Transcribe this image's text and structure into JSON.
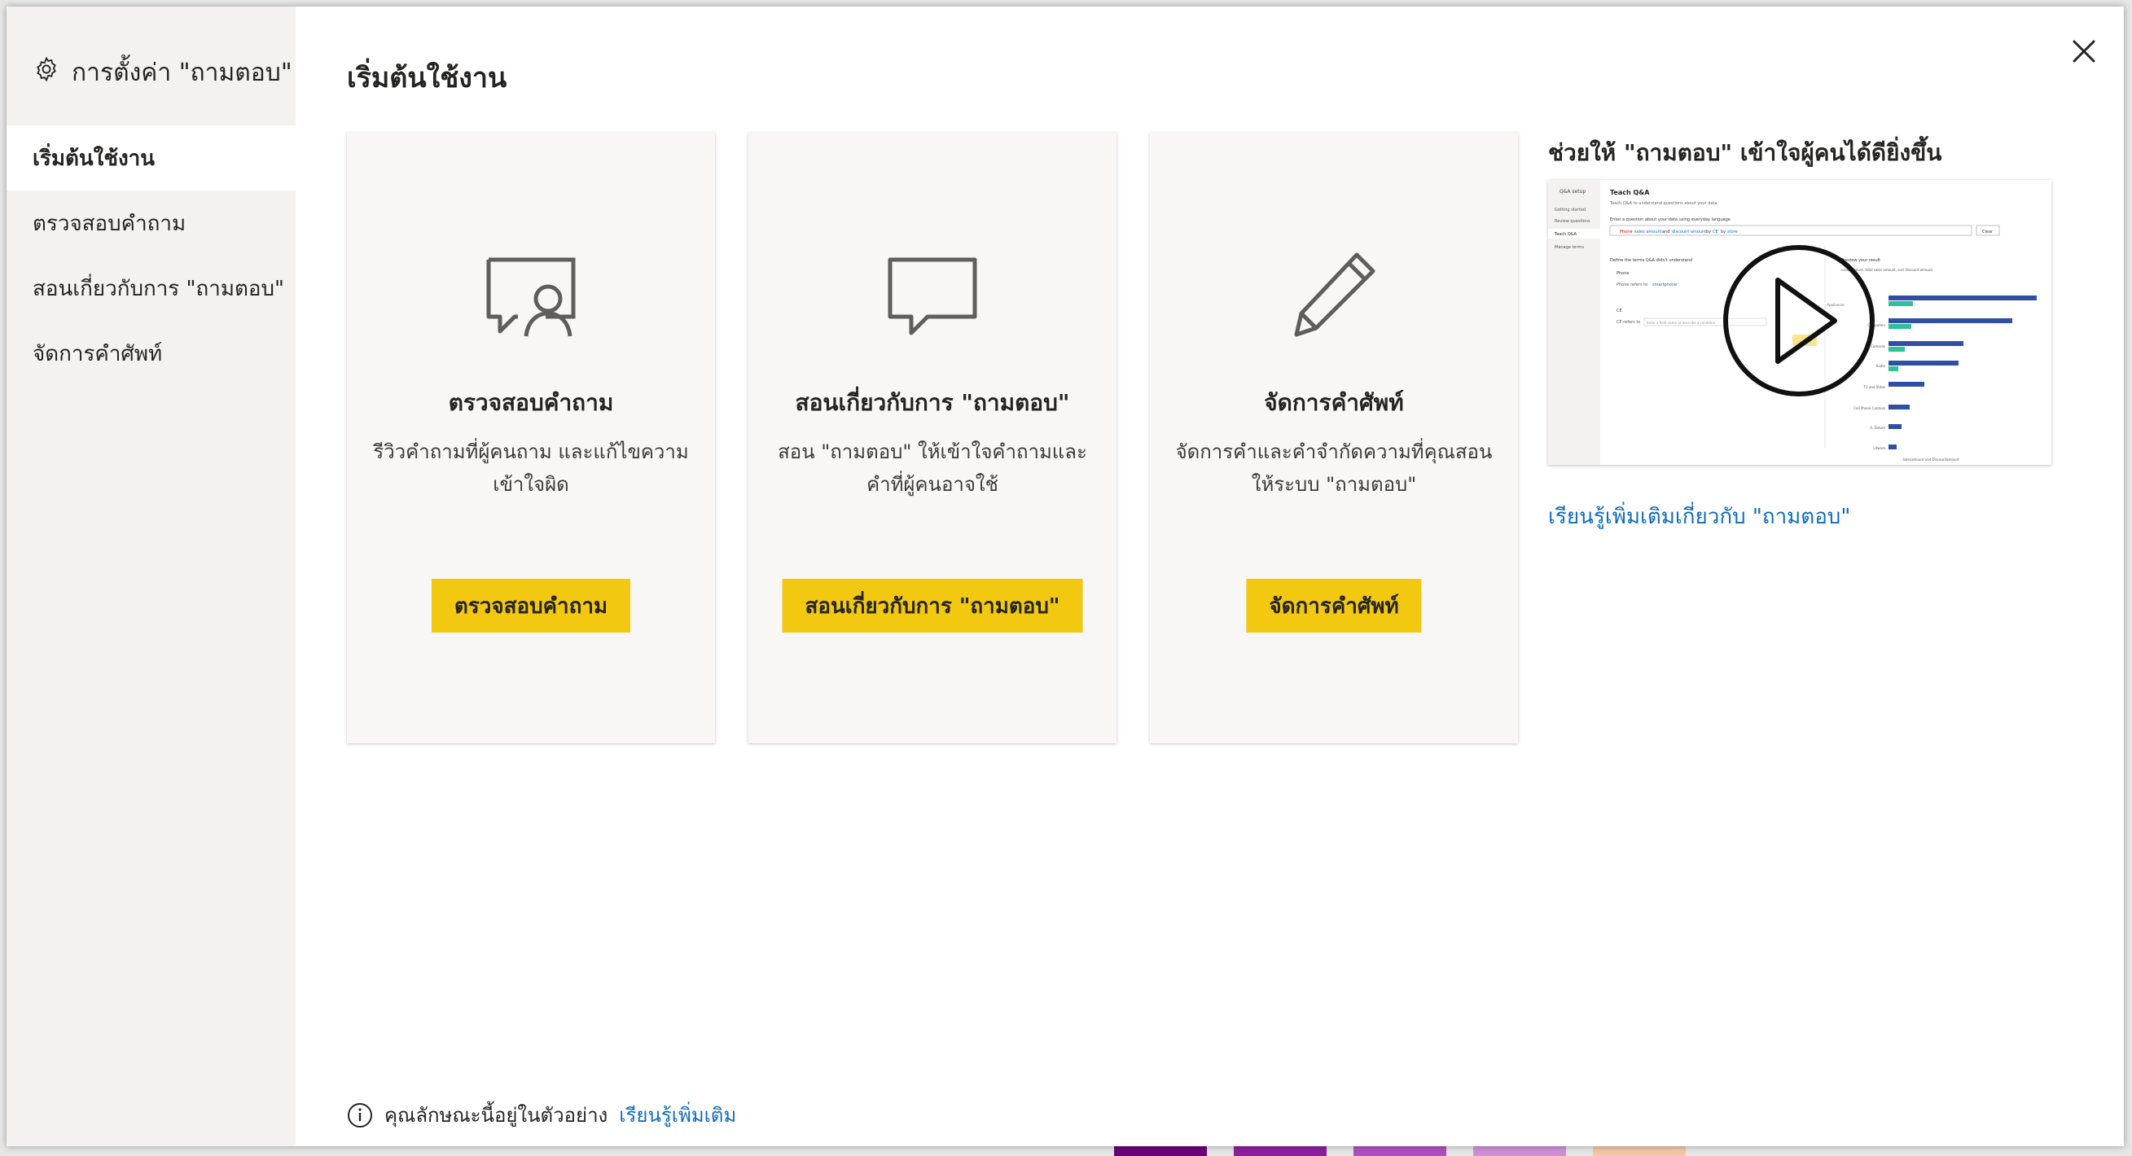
{
  "sidebar": {
    "header": "การตั้งค่า \"ถามตอบ\"",
    "items": [
      {
        "label": "เริ่มต้นใช้งาน",
        "active": true
      },
      {
        "label": "ตรวจสอบคำถาม",
        "active": false
      },
      {
        "label": "สอนเกี่ยวกับการ \"ถามตอบ\"",
        "active": false
      },
      {
        "label": "จัดการคำศัพท์",
        "active": false
      }
    ]
  },
  "main": {
    "title": "เริ่มต้นใช้งาน",
    "cards": [
      {
        "icon": "review-questions-icon",
        "title": "ตรวจสอบคำถาม",
        "desc_line1": "รีวิวคำถามที่ผู้คนถาม และแก้ไขความ",
        "desc_line2": "เข้าใจผิด",
        "button": "ตรวจสอบคำถาม"
      },
      {
        "icon": "chat-bubble-icon",
        "title": "สอนเกี่ยวกับการ \"ถามตอบ\"",
        "desc_line1": "สอน \"ถามตอบ\" ให้เข้าใจคำถามและ",
        "desc_line2": "คำที่ผู้คนอาจใช้",
        "button": "สอนเกี่ยวกับการ \"ถามตอบ\""
      },
      {
        "icon": "pencil-icon",
        "title": "จัดการคำศัพท์",
        "desc_line1": "จัดการคำและคำจำกัดความที่คุณสอน",
        "desc_line2": "ให้ระบบ \"ถามตอบ\"",
        "button": "จัดการคำศัพท์"
      }
    ],
    "video": {
      "title": "ช่วยให้ \"ถามตอบ\" เข้าใจผู้คนได้ดียิ่งขึ้น",
      "thumb": {
        "app_title": "Q&A setup",
        "nav": [
          "Getting started",
          "Review questions",
          "Teach Q&A",
          "Manage terms"
        ],
        "heading": "Teach Q&A",
        "subheading": "Teach Q&A to understand questions about your data",
        "prompt": "Enter a question about your data using everyday language",
        "input_prefix": "Phone",
        "input_link1": "sales amount",
        "input_and": "and",
        "input_link2": "discount amount",
        "input_by": "by",
        "input_link3": "CE",
        "input_suffix": "by",
        "input_link4": "store",
        "clear_btn": "Clear",
        "define_label": "Define the terms Q&A didn't understand",
        "term1": "Phone",
        "refers_to": "Phone refers to",
        "refers_value": "smartphone",
        "term2": "CE",
        "ce_refers": "CE refers to",
        "ce_placeholder": "Enter a field name or describe a condition",
        "preview_label": "Preview your result",
        "legend": "sales amount, total sales amount, sort discount amount",
        "bars_ylabels": [
          "Appliances",
          "Computers",
          "Cameras",
          "Audio",
          "TV and Video",
          "Cell Phone Contoso",
          "A. Datum",
          "Litware"
        ],
        "x_title": "Salesamount and Discountamount"
      },
      "play_icon": "play-icon"
    },
    "learn_more_qna": "เรียนรู้เพิ่มเติมเกี่ยวกับ \"ถามตอบ\""
  },
  "footer": {
    "text": "คุณลักษณะนี้อยู่ในตัวอย่าง",
    "link": "เรียนรู้เพิ่มเติม"
  },
  "colors": {
    "accent_yellow": "#f2c811",
    "link_blue": "#0f6cbd",
    "sidebar_bg": "#f3f2f1",
    "card_bg": "#f8f7f6"
  }
}
